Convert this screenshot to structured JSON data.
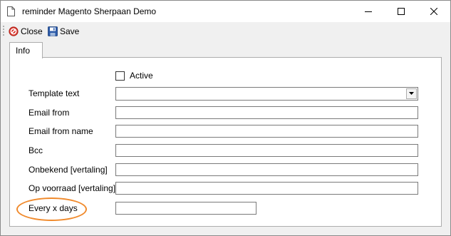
{
  "window": {
    "title": "reminder Magento Sherpaan Demo"
  },
  "toolbar": {
    "close_label": "Close",
    "save_label": "Save"
  },
  "tabs": [
    {
      "label": "Info",
      "active": true
    }
  ],
  "form": {
    "active_label": "Active",
    "active_checked": false,
    "template_text_label": "Template text",
    "template_text_value": "",
    "email_from_label": "Email from",
    "email_from_value": "",
    "email_from_name_label": "Email from name",
    "email_from_name_value": "",
    "bcc_label": "Bcc",
    "bcc_value": "",
    "onbekend_label": "Onbekend [vertaling]",
    "onbekend_value": "",
    "op_voorraad_label": "Op voorraad [vertaling]",
    "op_voorraad_value": "",
    "every_x_days_label": "Every x days",
    "every_x_days_value": ""
  },
  "colors": {
    "highlight_ellipse": "#f08a2c",
    "close_icon": "#d9342b",
    "save_icon": "#2b5aa8"
  },
  "icons": [
    "document-icon",
    "minimize-icon",
    "maximize-icon",
    "close-icon",
    "toolbar-close-icon",
    "save-icon",
    "dropdown-arrow-icon"
  ]
}
